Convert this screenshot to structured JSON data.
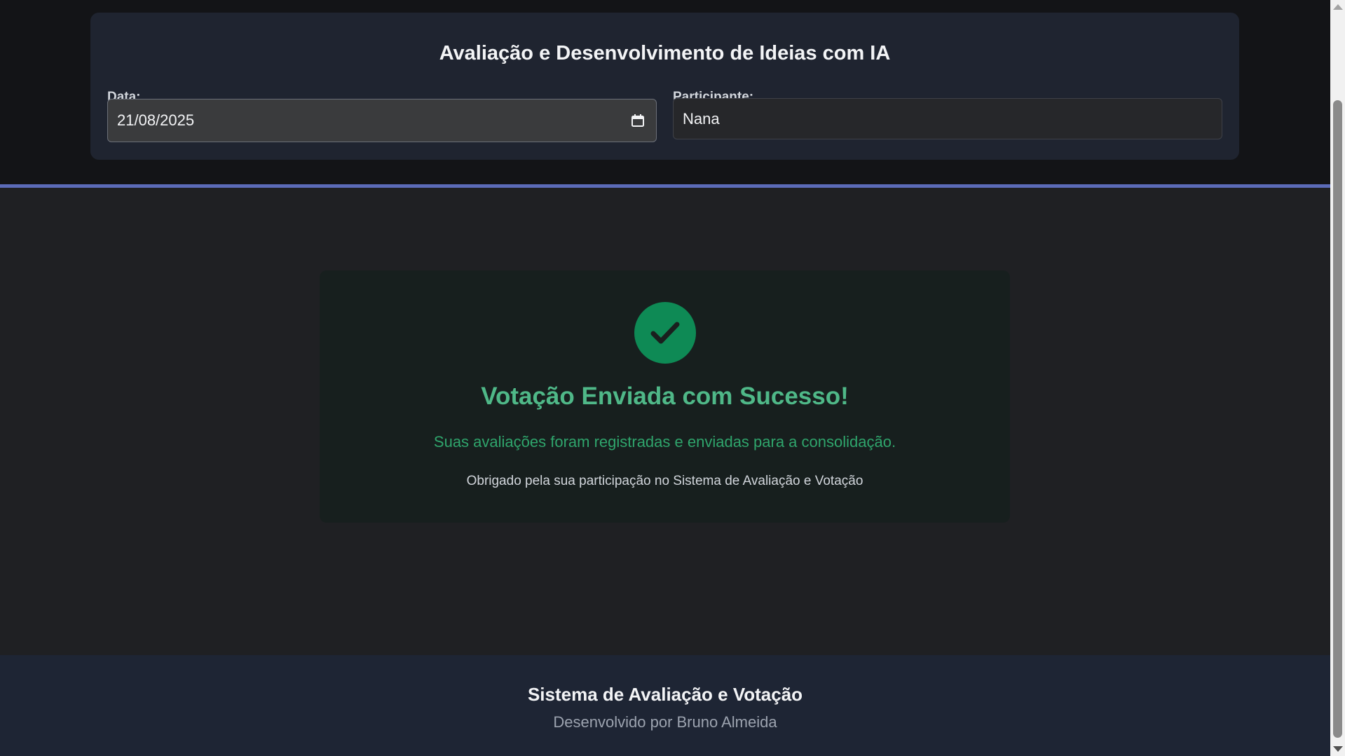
{
  "header": {
    "title": "Avaliação e Desenvolvimento de Ideias com IA",
    "date_label": "Data:",
    "date_value": "21/08/2025",
    "participant_label": "Participante:",
    "participant_value": "Nana"
  },
  "success": {
    "icon": "check-circle-icon",
    "title": "Votação Enviada com Sucesso!",
    "message": "Suas avaliações foram registradas e enviadas para a consolidação.",
    "thanks": "Obrigado pela sua participação no Sistema de Avaliação e Votação"
  },
  "footer": {
    "title": "Sistema de Avaliação e Votação",
    "subtitle": "Desenvolvido por Bruno Almeida"
  },
  "colors": {
    "accent_divider": "#5b6bb8",
    "success_green": "#0e8a55",
    "success_text": "#4fb888"
  }
}
